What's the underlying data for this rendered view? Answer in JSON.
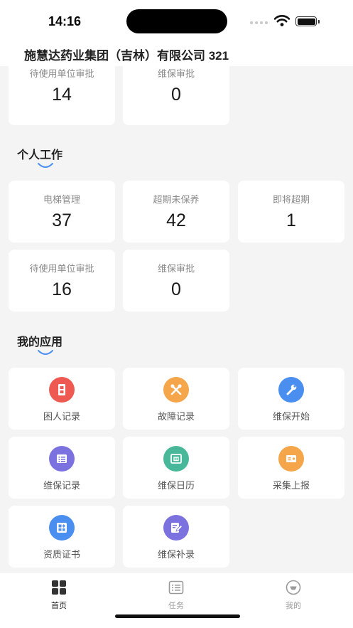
{
  "status": {
    "time": "14:16"
  },
  "header": {
    "title": "施慧达药业集团（吉林）有限公司 321"
  },
  "top_stats": [
    {
      "label": "待使用单位审批",
      "value": "14"
    },
    {
      "label": "维保审批",
      "value": "0"
    }
  ],
  "personal": {
    "title": "个人工作",
    "stats": [
      {
        "label": "电梯管理",
        "value": "37"
      },
      {
        "label": "超期未保养",
        "value": "42"
      },
      {
        "label": "即将超期",
        "value": "1"
      },
      {
        "label": "待使用单位审批",
        "value": "16"
      },
      {
        "label": "维保审批",
        "value": "0"
      }
    ]
  },
  "apps": {
    "title": "我的应用",
    "items": [
      {
        "label": "困人记录",
        "icon": "elevator-icon",
        "color": "#ee5a52"
      },
      {
        "label": "故障记录",
        "icon": "tools-icon",
        "color": "#f5a54a"
      },
      {
        "label": "维保开始",
        "icon": "wrench-icon",
        "color": "#4a8ef0"
      },
      {
        "label": "维保记录",
        "icon": "list-icon",
        "color": "#7b72e0"
      },
      {
        "label": "维保日历",
        "icon": "calendar-icon",
        "color": "#49b89a"
      },
      {
        "label": "采集上报",
        "icon": "report-icon",
        "color": "#f5a54a"
      },
      {
        "label": "资质证书",
        "icon": "certificate-icon",
        "color": "#4a8ef0"
      },
      {
        "label": "维保补录",
        "icon": "edit-record-icon",
        "color": "#7b72e0"
      }
    ]
  },
  "tabs": [
    {
      "label": "首页",
      "icon": "home-grid-icon",
      "active": true
    },
    {
      "label": "任务",
      "icon": "task-list-icon",
      "active": false
    },
    {
      "label": "我的",
      "icon": "profile-icon",
      "active": false
    }
  ],
  "colors": {
    "accent": "#4a8ef0",
    "background": "#f4f4f4"
  }
}
